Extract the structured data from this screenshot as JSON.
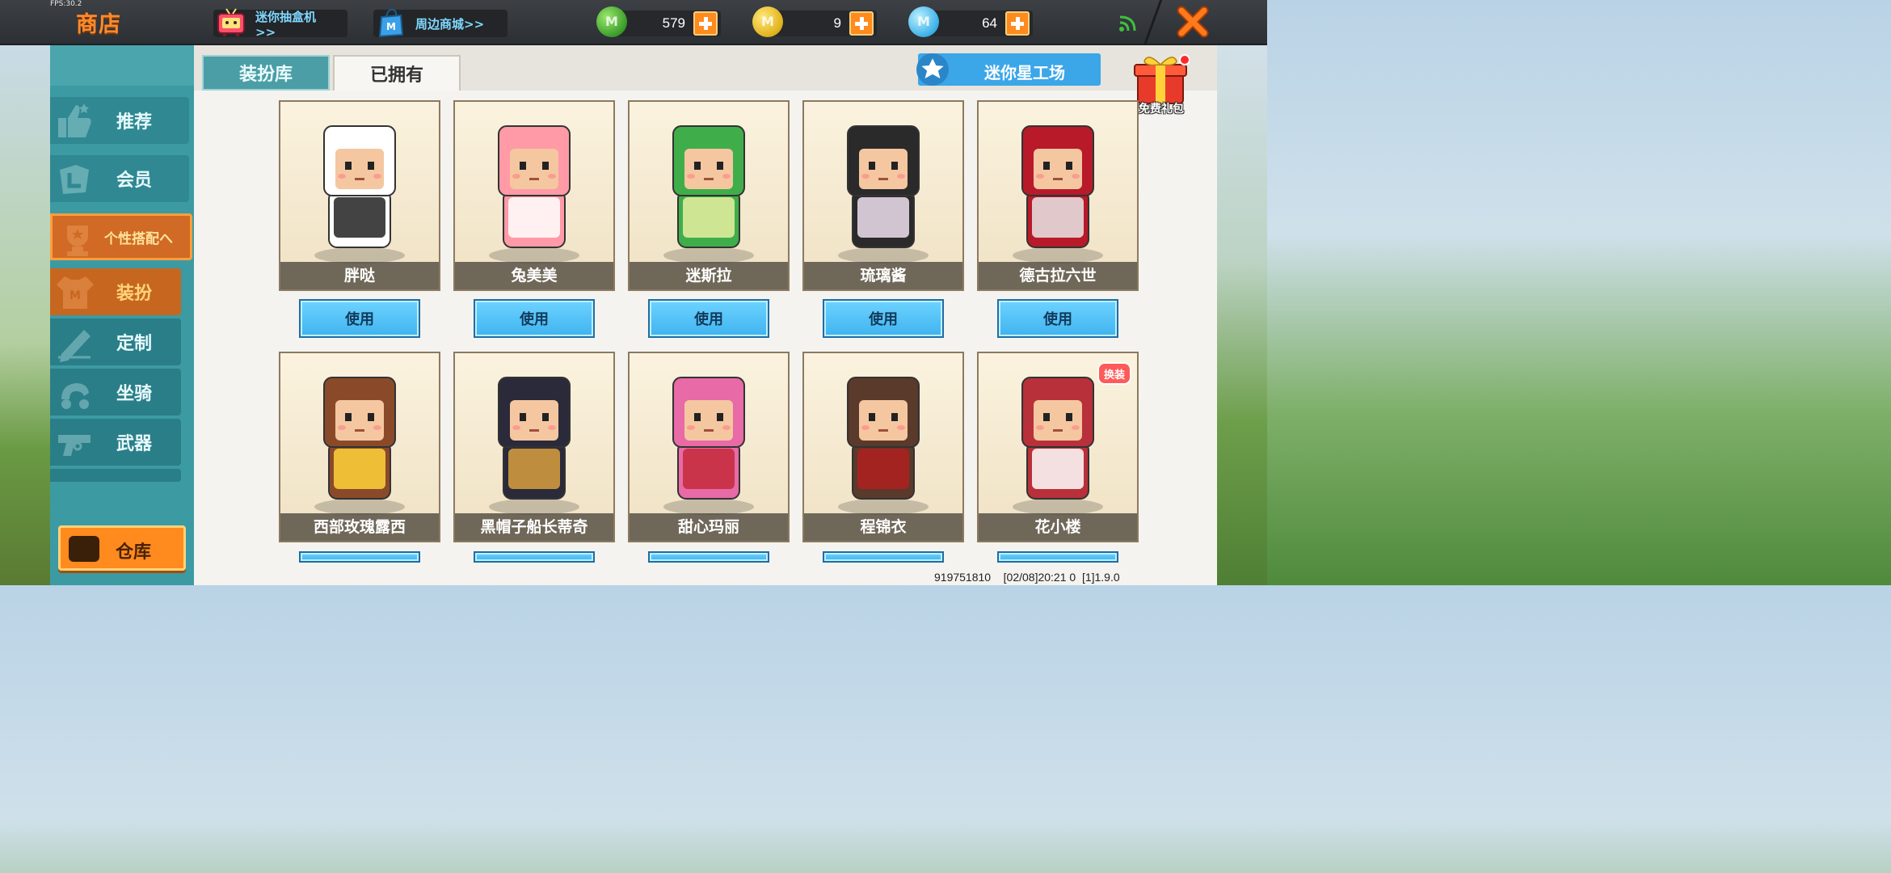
{
  "status": {
    "fps": "FPS:30.2"
  },
  "header": {
    "title": "商店",
    "links": [
      {
        "label": "迷你抽盒机>>",
        "icon": "tv-icon"
      },
      {
        "label": "周边商城>>",
        "icon": "shopping-bag-icon"
      }
    ],
    "currencies": [
      {
        "name": "mini-bean",
        "value": "579",
        "color": "#3a9c2a"
      },
      {
        "name": "mini-coin",
        "value": "9",
        "color": "#e0b11c"
      },
      {
        "name": "mini-point",
        "value": "64",
        "color": "#3bb0e8"
      }
    ]
  },
  "sidebar": {
    "items": [
      {
        "label": "推荐"
      },
      {
        "label": "会员"
      },
      {
        "label": "个性搭配へ"
      },
      {
        "label": "装扮"
      },
      {
        "label": "定制"
      },
      {
        "label": "坐骑"
      },
      {
        "label": "武器"
      }
    ],
    "warehouse_label": "仓库"
  },
  "tabs": [
    {
      "label": "装扮库"
    },
    {
      "label": "已拥有"
    }
  ],
  "star_workshop_label": "迷你星工场",
  "gift_label": "免费礼包",
  "use_label": "使用",
  "skins_row1": [
    "胖哒",
    "兔美美",
    "迷斯拉",
    "琉璃酱",
    "德古拉六世"
  ],
  "skins_row2": [
    "西部玫瑰露西",
    "黑帽子船长蒂奇",
    "甜心玛丽",
    "程锦衣",
    "花小楼"
  ],
  "swap_badge": "换装",
  "footer": {
    "uid": "919751810",
    "info": "[02/08]20:21 0  [1]1.9.0"
  },
  "colors": {
    "accent_orange": "#ff8a1e",
    "sidebar_teal": "#3c9aa3",
    "button_blue": "#3fb3ef"
  }
}
